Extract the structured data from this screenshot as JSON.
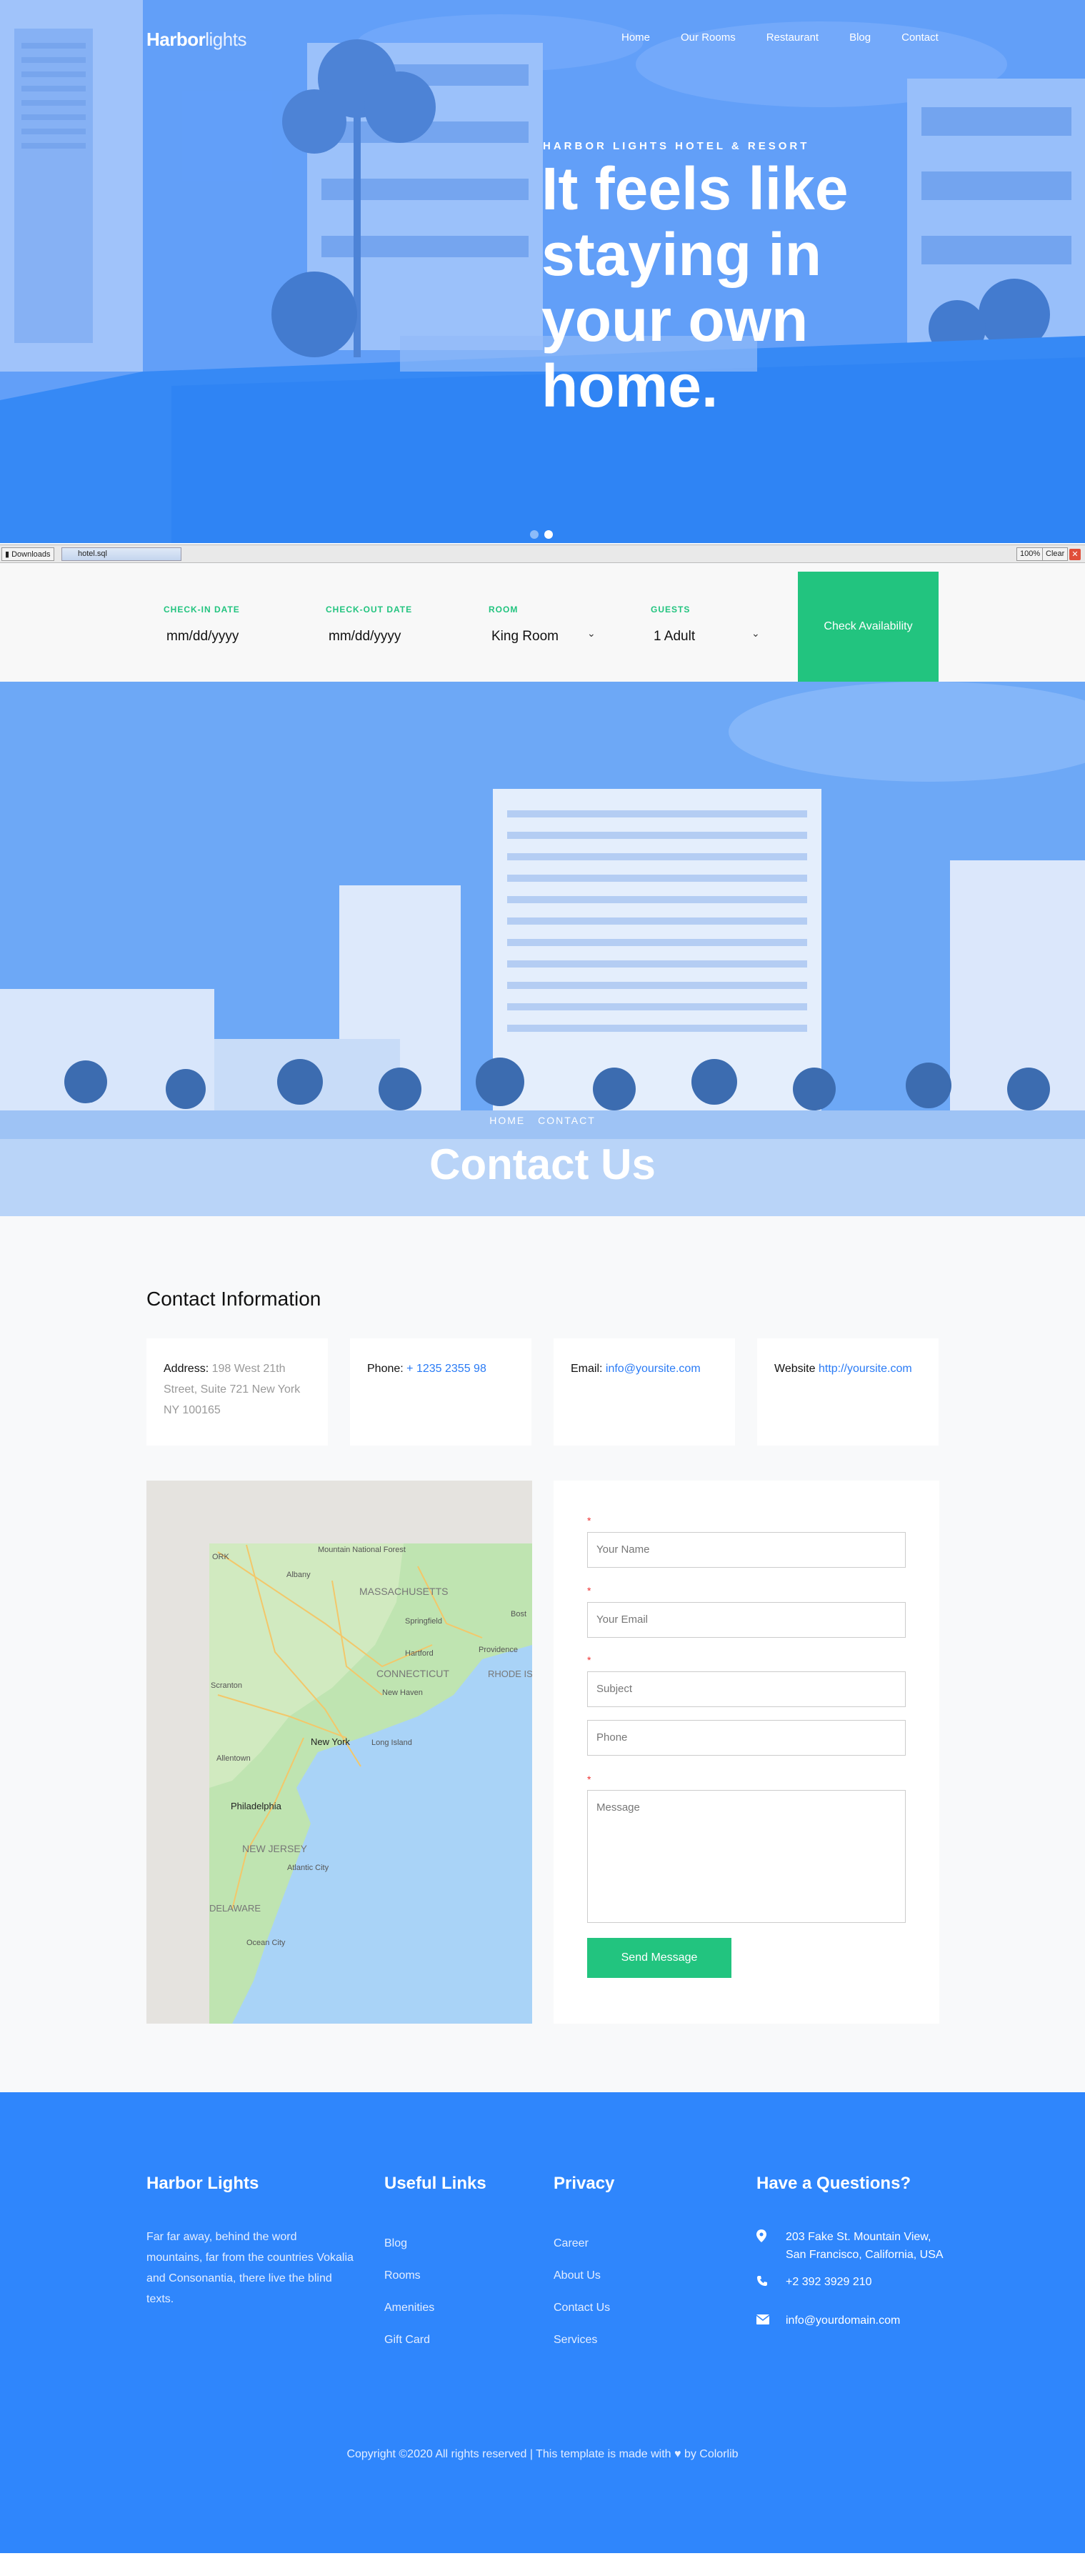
{
  "brand": {
    "part1": "Harbor",
    "part2": "lights"
  },
  "nav": [
    "Home",
    "Our Rooms",
    "Restaurant",
    "Blog",
    "Contact"
  ],
  "hero": {
    "subheading": "HARBOR LIGHTS HOTEL & RESORT",
    "title": "It feels like staying in your own home.",
    "slides": 2,
    "active_slide": 2
  },
  "download_bar": {
    "downloads_label": "Downloads",
    "file": "hotel.sql",
    "zoom": "100%",
    "clear": "Clear"
  },
  "availability": {
    "checkin_label": "CHECK-IN DATE",
    "checkin_value": "mm/dd/yyyy",
    "checkout_label": "CHECK-OUT DATE",
    "checkout_value": "mm/dd/yyyy",
    "room_label": "ROOM",
    "room_value": "King Room",
    "guests_label": "GUESTS",
    "guests_value": "1 Adult",
    "button": "Check Availability"
  },
  "page_header": {
    "crumb_home": "HOME",
    "crumb_current": "CONTACT",
    "title": "Contact Us"
  },
  "contact_info": {
    "title": "Contact Information",
    "address_label": "Address:",
    "address": "198 West 21th Street, Suite 721 New York NY 100165",
    "phone_label": "Phone:",
    "phone": "+ 1235 2355 98",
    "email_label": "Email:",
    "email": "info@yoursite.com",
    "website_label": "Website",
    "website": "http://yoursite.com"
  },
  "map": {
    "labels": [
      "ORK",
      "Mountain National Forest",
      "Albany",
      "MASSACHUSETTS",
      "Bost",
      "Springfield",
      "Hartford",
      "Providence",
      "RHODE ISLAND",
      "CONNECTICUT",
      "New Haven",
      "Scranton",
      "New York",
      "Long Island",
      "Allentown",
      "Philadelphia",
      "NEW JERSEY",
      "Atlantic City",
      "DELAWARE",
      "Ocean City"
    ]
  },
  "form": {
    "name_ph": "Your Name",
    "email_ph": "Your Email",
    "subject_ph": "Subject",
    "phone_ph": "Phone",
    "message_ph": "Message",
    "submit": "Send Message",
    "required_mark": "*"
  },
  "footer": {
    "about_title": "Harbor Lights",
    "about_text": "Far far away, behind the word mountains, far from the countries Vokalia and Consonantia, there live the blind texts.",
    "links_title": "Useful Links",
    "links": [
      "Blog",
      "Rooms",
      "Amenities",
      "Gift Card"
    ],
    "privacy_title": "Privacy",
    "privacy": [
      "Career",
      "About Us",
      "Contact Us",
      "Services"
    ],
    "questions_title": "Have a Questions?",
    "address": "203 Fake St. Mountain View, San Francisco, California, USA",
    "phone": "+2 392 3929 210",
    "email": "info@yourdomain.com",
    "copyright": "Copyright ©2020 All rights reserved | This template is made with",
    "copyright_by": "by Colorlib"
  },
  "colors": {
    "accent_green": "#22c47f",
    "footer_blue": "#2f86fc",
    "link_blue": "#2a7bf5"
  }
}
